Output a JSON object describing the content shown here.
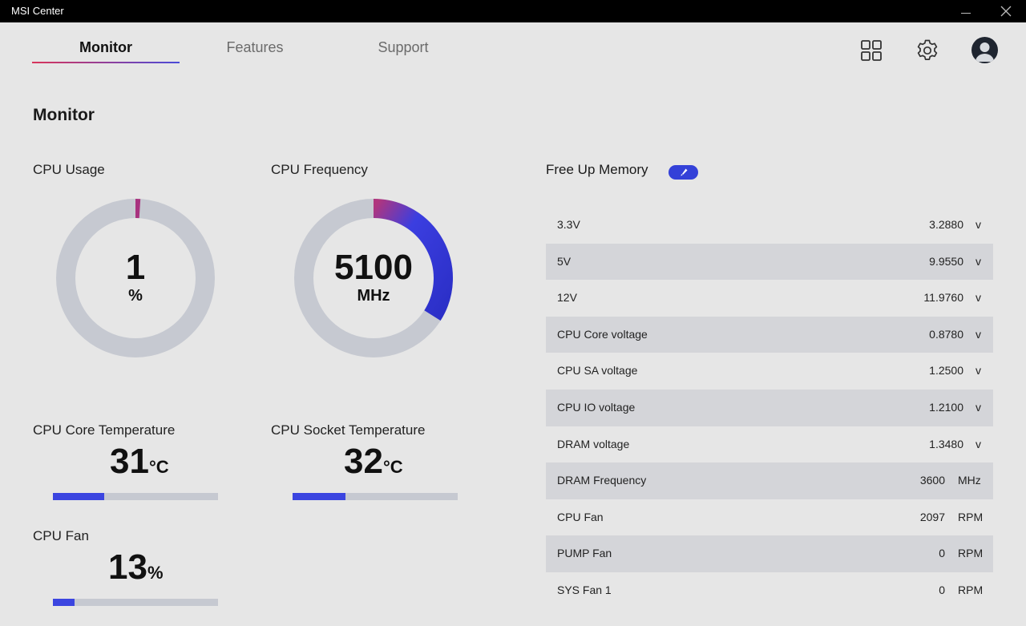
{
  "window": {
    "title": "MSI Center"
  },
  "tabs": [
    {
      "label": "Monitor",
      "active": true
    },
    {
      "label": "Features",
      "active": false
    },
    {
      "label": "Support",
      "active": false
    }
  ],
  "page_title": "Monitor",
  "cpu_usage": {
    "label": "CPU Usage",
    "value": "1",
    "unit": "%",
    "percent": 1
  },
  "cpu_frequency": {
    "label": "CPU Frequency",
    "value": "5100",
    "unit": "MHz",
    "percent": 34
  },
  "cpu_core_temp": {
    "label": "CPU Core Temperature",
    "value": "31",
    "unit": "°C",
    "percent": 31
  },
  "cpu_socket_temp": {
    "label": "CPU Socket Temperature",
    "value": "32",
    "unit": "°C",
    "percent": 32
  },
  "cpu_fan": {
    "label": "CPU Fan",
    "value": "13",
    "unit": "%",
    "percent": 13
  },
  "free_up_memory": {
    "label": "Free Up Memory"
  },
  "sensors": [
    {
      "name": "3.3V",
      "value": "3.2880",
      "unit": "v"
    },
    {
      "name": "5V",
      "value": "9.9550",
      "unit": "v"
    },
    {
      "name": "12V",
      "value": "11.9760",
      "unit": "v"
    },
    {
      "name": "CPU Core voltage",
      "value": "0.8780",
      "unit": "v"
    },
    {
      "name": "CPU SA voltage",
      "value": "1.2500",
      "unit": "v"
    },
    {
      "name": "CPU IO voltage",
      "value": "1.2100",
      "unit": "v"
    },
    {
      "name": "DRAM voltage",
      "value": "1.3480",
      "unit": "v"
    },
    {
      "name": "DRAM Frequency",
      "value": "3600",
      "unit": "MHz"
    },
    {
      "name": "CPU Fan",
      "value": "2097",
      "unit": "RPM"
    },
    {
      "name": "PUMP Fan",
      "value": "0",
      "unit": "RPM"
    },
    {
      "name": "SYS Fan 1",
      "value": "0",
      "unit": "RPM"
    }
  ],
  "icons": {
    "apps": "grid-icon",
    "settings": "gear-icon",
    "profile": "avatar-icon",
    "free_memory": "rocket-icon"
  },
  "colors": {
    "accent": "#3b45e0",
    "gauge_track": "#c6c9d1",
    "gauge_start": "#b0357e",
    "tab_underline_start": "#d9345a",
    "tab_underline_end": "#4a4ad8"
  }
}
